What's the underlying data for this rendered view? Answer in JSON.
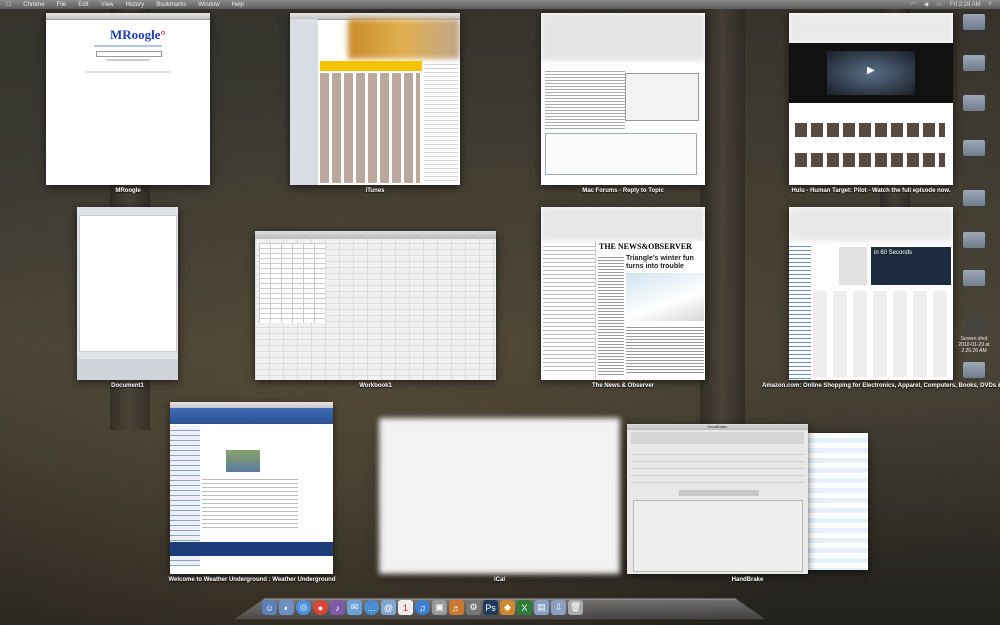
{
  "menubar": {
    "apple": "",
    "items": [
      "Chrome",
      "File",
      "Edit",
      "View",
      "History",
      "Bookmarks",
      "Window",
      "Help"
    ],
    "right_text": [
      "Fri 2:28 AM"
    ]
  },
  "windows": {
    "mroogle": {
      "caption": "MRoogle",
      "logo_main": "MRoogle",
      "logo_suffix": "°"
    },
    "itunes": {
      "caption": "iTunes"
    },
    "macforums": {
      "caption": "Mac Forums - Reply to Topic"
    },
    "hulu": {
      "caption": "Hulu - Human Target: Pilot - Watch the full episode now."
    },
    "document": {
      "caption": "Document1"
    },
    "workbook": {
      "caption": "Workbook1"
    },
    "newsobserver": {
      "caption": "The News & Observer",
      "masthead": "THE NEWS&OBSERVER",
      "headline": "Triangle's winter fun turns into trouble"
    },
    "amazon": {
      "caption": "Amazon.com: Online Shopping for Electronics, Apparel, Computers, Books, DVDs & more",
      "promo": "in 60 Seconds"
    },
    "weather": {
      "caption": "Welcome to Weather Underground : Weather Underground"
    },
    "ical": {
      "caption": "iCal"
    },
    "handbrake": {
      "caption": "HandBrake",
      "title": "HandBrake"
    }
  },
  "desktop": {
    "items": [
      "Screen shot 2010-01-29 at 2.26.26 AM"
    ]
  },
  "colors": {
    "link_blue": "#1a3fb8",
    "amazon_orange": "#f0a020",
    "hulu_dark": "#111111",
    "itunes_blue": "#3b5ca8"
  }
}
